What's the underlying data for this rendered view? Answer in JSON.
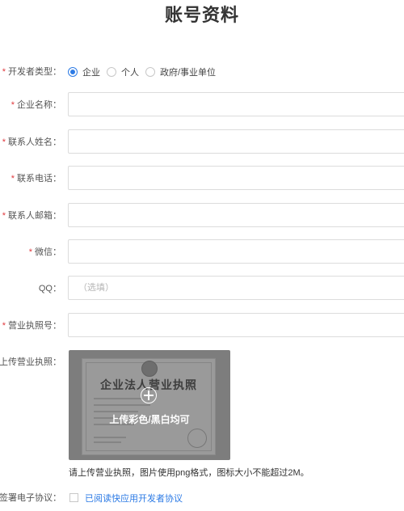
{
  "page": {
    "title": "账号资料"
  },
  "form": {
    "required_mark": "*",
    "developer_type": {
      "label": "开发者类型：",
      "options": [
        {
          "label": "企业",
          "checked": true
        },
        {
          "label": "个人",
          "checked": false
        },
        {
          "label": "政府/事业单位",
          "checked": false
        }
      ]
    },
    "company_name": {
      "label": "企业名称：",
      "value": "",
      "placeholder": ""
    },
    "contact_name": {
      "label": "联系人姓名：",
      "value": "",
      "placeholder": ""
    },
    "contact_phone": {
      "label": "联系电话：",
      "value": "",
      "placeholder": ""
    },
    "contact_email": {
      "label": "联系人邮箱：",
      "value": "",
      "placeholder": ""
    },
    "wechat": {
      "label": "微信：",
      "value": "",
      "placeholder": ""
    },
    "qq": {
      "label": "QQ：",
      "value": "",
      "placeholder": "（选填）"
    },
    "license_number": {
      "label": "营业执照号：",
      "value": "",
      "placeholder": ""
    },
    "license_upload": {
      "label": "上传营业执照：",
      "image_title": "企业法人营业执照",
      "upload_text": "上传彩色/黑白均可",
      "hint": "请上传营业执照，图片使用png格式，图标大小不能超过2M。"
    },
    "agreement": {
      "label": "签署电子协议：",
      "link_text": "已阅读快应用开发者协议",
      "checked": false
    }
  },
  "colors": {
    "accent": "#2d7be5",
    "required": "#e0393e",
    "upload_bg": "#7d7d7d"
  }
}
